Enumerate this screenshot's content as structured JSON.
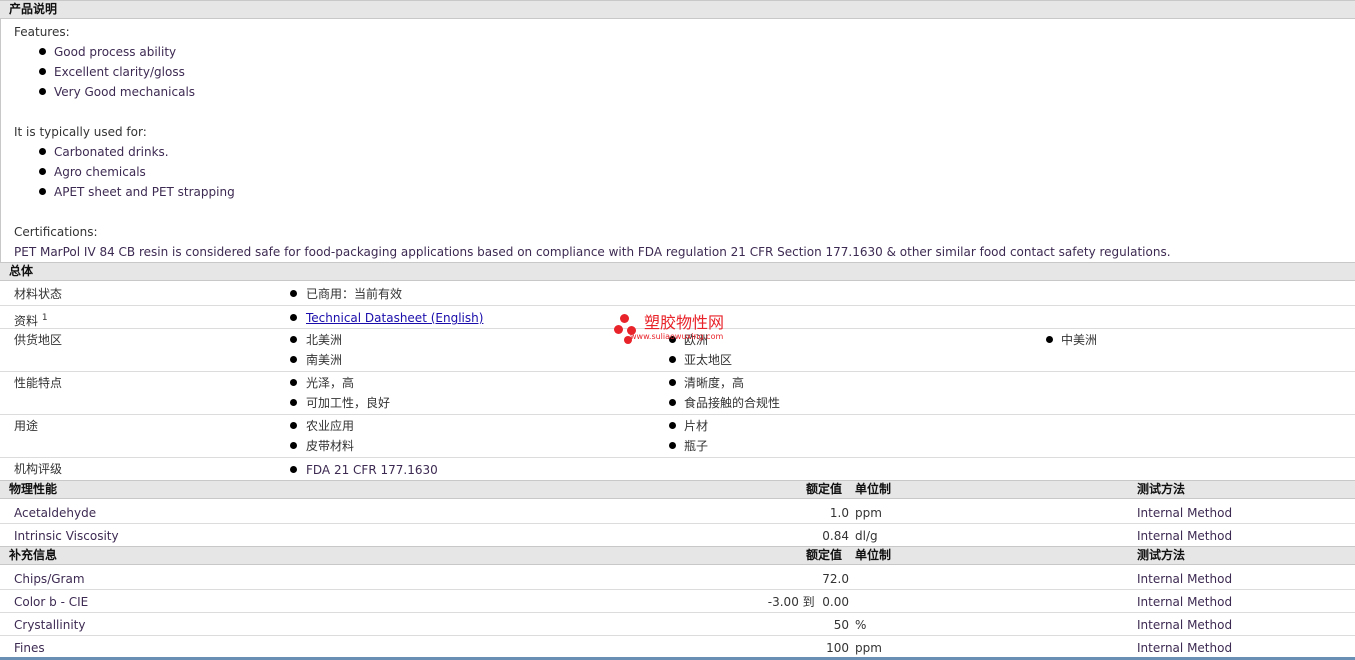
{
  "product_description": {
    "header": "产品说明",
    "features_label": "Features:",
    "features": [
      "Good process ability",
      "Excellent clarity/gloss",
      "Very Good mechanicals"
    ],
    "uses_label": "It is typically used for:",
    "uses": [
      "Carbonated drinks.",
      "Agro chemicals",
      "APET sheet and PET strapping"
    ],
    "cert_label": "Certifications:",
    "cert_text": "PET MarPol IV 84 CB resin is considered safe for food-packaging applications based on compliance with FDA regulation 21 CFR Section 177.1630 & other similar food contact safety regulations."
  },
  "general": {
    "header": "总体",
    "rows": {
      "material_status": {
        "label": "材料状态",
        "value": "已商用：当前有效"
      },
      "docs": {
        "label": "资料",
        "sup": "1",
        "value": "Technical Datasheet (English)"
      },
      "regions": {
        "label": "供货地区",
        "values": [
          "北美洲",
          "欧洲",
          "中美洲",
          "南美洲",
          "亚太地区"
        ]
      },
      "features": {
        "label": "性能特点",
        "values": [
          "光泽，高",
          "清晰度，高",
          "可加工性，良好",
          "食品接触的合规性"
        ]
      },
      "uses": {
        "label": "用途",
        "values": [
          "农业应用",
          "片材",
          "皮带材料",
          "瓶子"
        ]
      },
      "agency": {
        "label": "机构评级",
        "value": "FDA 21 CFR 177.1630"
      }
    }
  },
  "watermark": {
    "title": "塑胶物性网",
    "url": "www.suliaowuxing.com"
  },
  "physical": {
    "header": "物理性能",
    "col_nominal": "额定值",
    "col_unit": "单位制",
    "col_method": "测试方法",
    "rows": [
      {
        "name": "Acetaldehyde",
        "value": "1.0",
        "unit": "ppm",
        "method": "Internal Method"
      },
      {
        "name": "Intrinsic Viscosity",
        "value": "0.84",
        "unit": "dl/g",
        "method": "Internal Method"
      }
    ]
  },
  "additional": {
    "header": "补充信息",
    "col_nominal": "额定值",
    "col_unit": "单位制",
    "col_method": "测试方法",
    "rows": [
      {
        "name": "Chips/Gram",
        "value": "72.0",
        "unit": "",
        "method": "Internal Method"
      },
      {
        "name": "Color b - CIE",
        "value": "-3.00 到  0.00",
        "unit": "",
        "method": "Internal Method"
      },
      {
        "name": "Crystallinity",
        "value": "50",
        "unit": "%",
        "method": "Internal Method"
      },
      {
        "name": "Fines",
        "value": "100",
        "unit": "ppm",
        "method": "Internal Method"
      }
    ]
  }
}
